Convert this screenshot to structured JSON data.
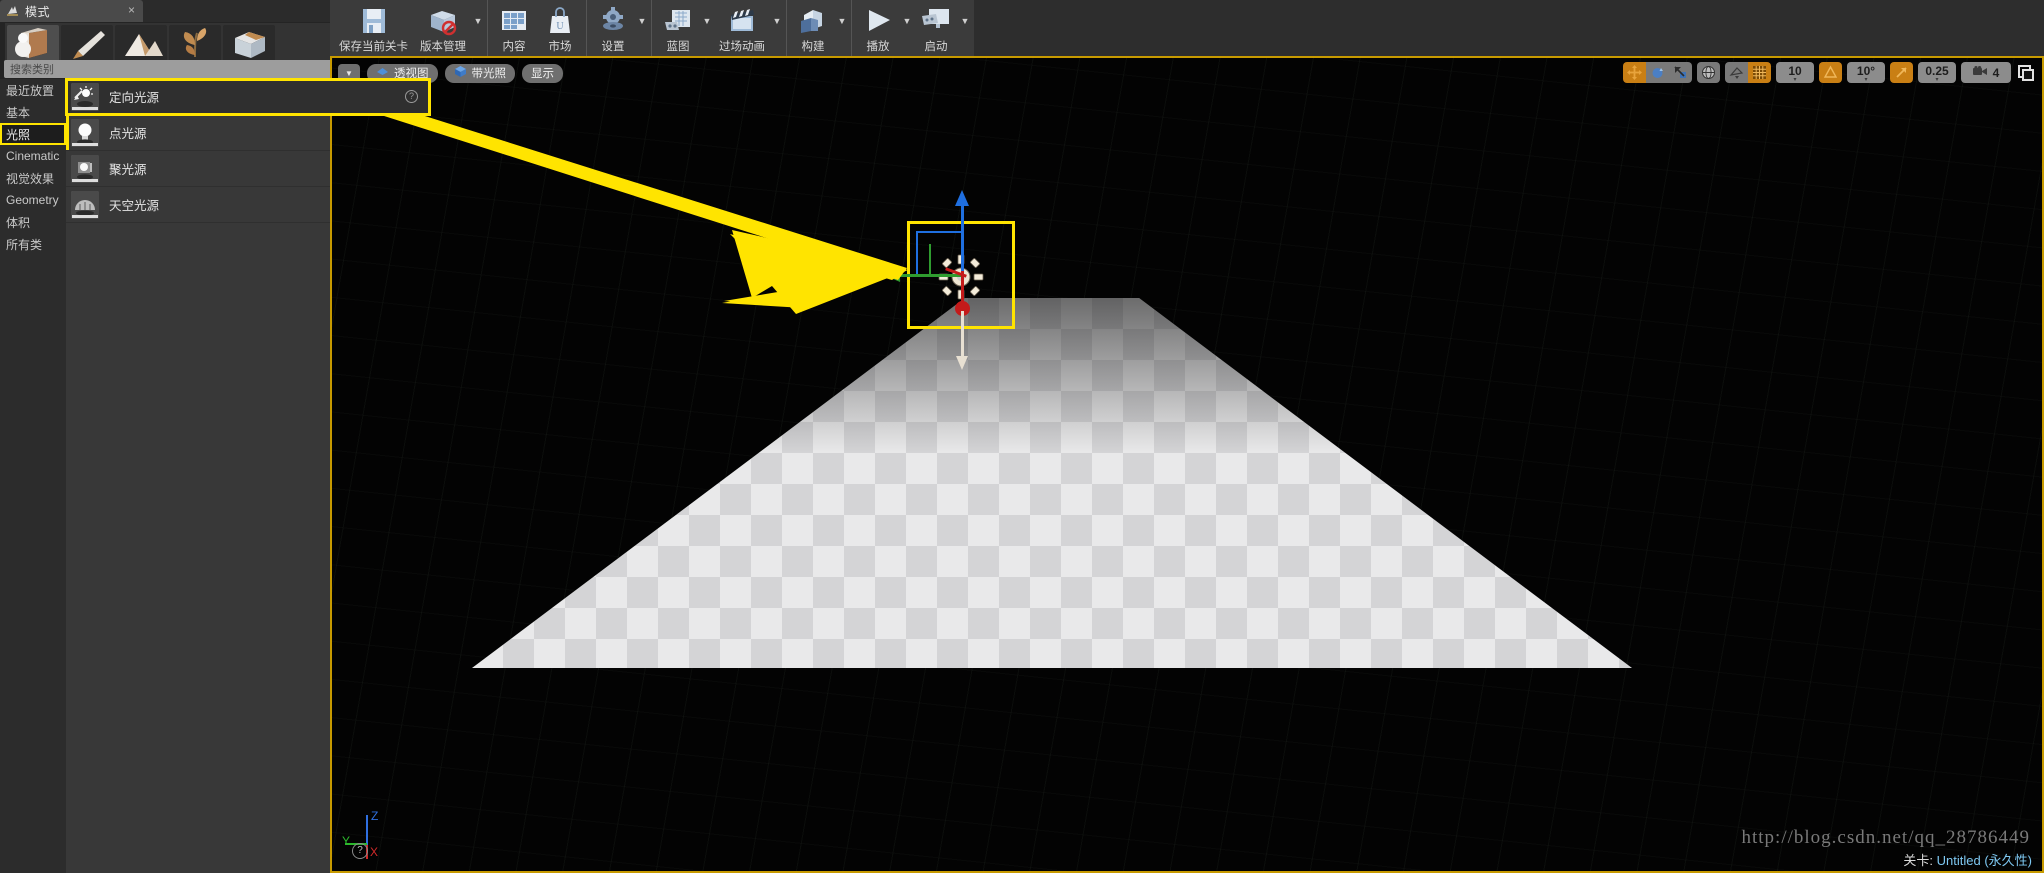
{
  "left_panel": {
    "tab": {
      "label": "模式",
      "icon": "modes-icon",
      "close": "×"
    },
    "mode_buttons": [
      {
        "name": "place-mode",
        "icon": "place-cube-icon",
        "active": true
      },
      {
        "name": "paint-mode",
        "icon": "paint-brush-icon",
        "active": false
      },
      {
        "name": "landscape-mode",
        "icon": "landscape-mountain-icon",
        "active": false
      },
      {
        "name": "foliage-mode",
        "icon": "foliage-leaf-icon",
        "active": false
      },
      {
        "name": "geometry-mode",
        "icon": "geometry-brush-icon",
        "active": false
      }
    ],
    "search": {
      "placeholder": "搜索类别",
      "icon": "search-icon"
    },
    "categories": [
      {
        "label": "最近放置",
        "active": false
      },
      {
        "label": "基本",
        "active": false
      },
      {
        "label": "光照",
        "active": true
      },
      {
        "label": "Cinematic",
        "active": false
      },
      {
        "label": "视觉效果",
        "active": false
      },
      {
        "label": "Geometry",
        "active": false
      },
      {
        "label": "体积",
        "active": false
      },
      {
        "label": "所有类",
        "active": false
      }
    ],
    "items": [
      {
        "label": "定向光源",
        "icon": "directional-light-icon",
        "help": "?",
        "highlighted": true
      },
      {
        "label": "点光源",
        "icon": "point-light-icon",
        "help": "?",
        "highlighted": false
      },
      {
        "label": "聚光源",
        "icon": "spot-light-icon",
        "help": "?",
        "highlighted": false
      },
      {
        "label": "天空光源",
        "icon": "sky-light-icon",
        "help": "?",
        "highlighted": false
      }
    ]
  },
  "toolbar": {
    "groups": [
      {
        "buttons": [
          {
            "label": "保存当前关卡",
            "icon": "save-icon",
            "caret": false
          },
          {
            "label": "版本管理",
            "icon": "source-control-icon",
            "caret": true
          }
        ]
      },
      {
        "buttons": [
          {
            "label": "内容",
            "icon": "content-browser-icon",
            "caret": false
          },
          {
            "label": "市场",
            "icon": "marketplace-icon",
            "caret": false
          }
        ]
      },
      {
        "buttons": [
          {
            "label": "设置",
            "icon": "settings-gear-icon",
            "caret": true
          }
        ]
      },
      {
        "buttons": [
          {
            "label": "蓝图",
            "icon": "blueprint-icon",
            "caret": true
          },
          {
            "label": "过场动画",
            "icon": "cinematics-clapper-icon",
            "caret": true
          }
        ]
      },
      {
        "buttons": [
          {
            "label": "构建",
            "icon": "build-icon",
            "caret": true
          }
        ]
      },
      {
        "buttons": [
          {
            "label": "播放",
            "icon": "play-icon",
            "caret": true
          },
          {
            "label": "启动",
            "icon": "launch-icon",
            "caret": true
          }
        ]
      }
    ]
  },
  "viewport": {
    "left_controls": {
      "menu_caret": "▼",
      "pills": [
        {
          "label": "透视图",
          "icon": "perspective-icon"
        },
        {
          "label": "带光照",
          "icon": "lit-cube-icon"
        },
        {
          "label": "显示",
          "icon": ""
        }
      ]
    },
    "right_controls": {
      "transform_modes": [
        {
          "name": "translate-mode",
          "icon": "move-arrows-icon",
          "active": true
        },
        {
          "name": "rotate-mode",
          "icon": "rotate-icon",
          "active": false
        },
        {
          "name": "scale-mode",
          "icon": "scale-icon",
          "active": false
        }
      ],
      "coordinate_system": {
        "name": "world-space-toggle",
        "icon": "globe-icon",
        "active": false
      },
      "surface_snap": {
        "name": "surface-snap-toggle",
        "icon": "surface-snap-icon",
        "active": false
      },
      "grid_snap": {
        "name": "grid-snap-toggle",
        "icon": "grid-icon",
        "active": true
      },
      "grid_size": "10",
      "angle_snap": {
        "name": "angle-snap-toggle",
        "icon": "angle-triangle-icon",
        "active": true
      },
      "angle_value": "10°",
      "scale_snap": {
        "name": "scale-snap-toggle",
        "icon": "scale-diagonal-icon",
        "active": true
      },
      "scale_value": "0.25",
      "camera_speed": {
        "icon": "camera-speed-icon",
        "value": "4"
      },
      "maximize": {
        "name": "maximize-viewport-button",
        "icon": "maximize-icon"
      }
    },
    "selection": {
      "label": "directional-light-selected"
    },
    "axis_widget": {
      "x": "X",
      "y": "Y",
      "z": "Z",
      "origin": "?"
    },
    "watermark": "http://blog.csdn.net/qq_28786449",
    "level_label_key": "关卡:",
    "level_label_value": "Untitled (永久性)"
  },
  "colors": {
    "highlight": "#ffe400",
    "accent_orange": "#c97f14",
    "panel_bg": "#383838",
    "viewport_bg": "#050505"
  }
}
